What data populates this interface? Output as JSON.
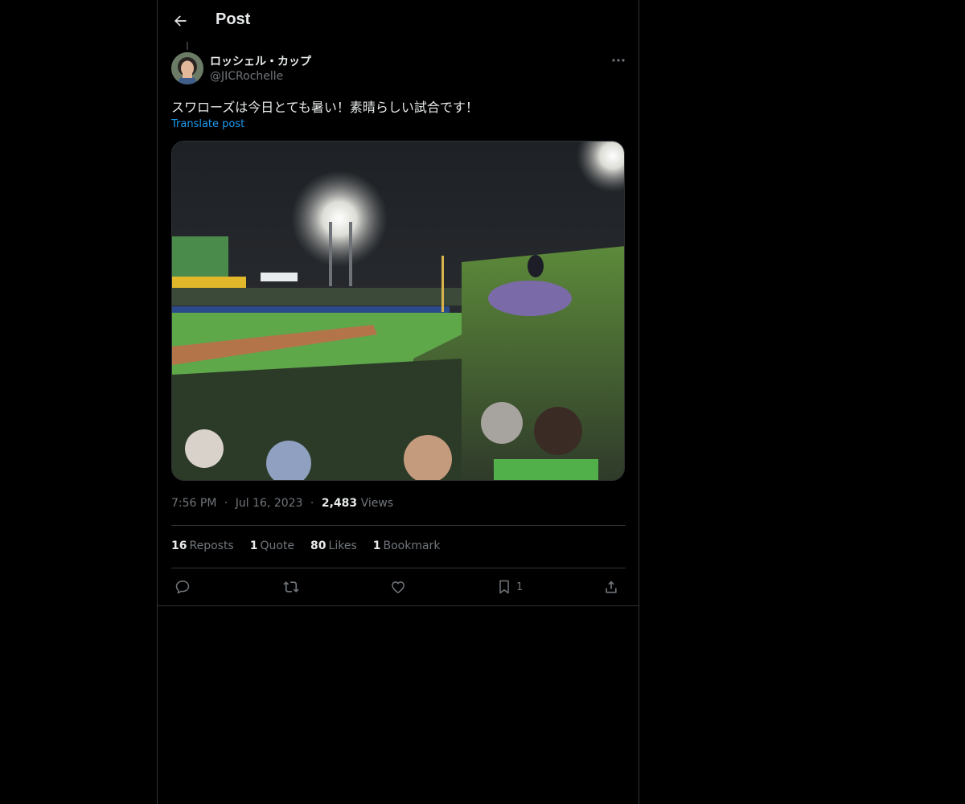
{
  "header": {
    "title": "Post",
    "back_icon": "arrow-left-icon"
  },
  "post": {
    "author_name": "ロッシェル・カップ",
    "author_handle": "@JICRochelle",
    "text": "スワローズは今日とても暑い！素晴らしい試合です！",
    "translate_label": "Translate post",
    "time": "7:56 PM",
    "date": "Jul 16, 2023",
    "views_count": "2,483",
    "views_label": "Views",
    "separator": "·"
  },
  "stats": [
    {
      "count": "16",
      "label": "Reposts"
    },
    {
      "count": "1",
      "label": "Quote"
    },
    {
      "count": "80",
      "label": "Likes"
    },
    {
      "count": "1",
      "label": "Bookmark"
    }
  ],
  "actions": {
    "reply_icon": "reply-icon",
    "repost_icon": "repost-icon",
    "like_icon": "heart-icon",
    "bookmark_icon": "bookmark-icon",
    "bookmark_count": "1",
    "share_icon": "share-icon"
  },
  "colors": {
    "accent": "#1d9bf0",
    "text": "#e7e9ea",
    "secondary": "#71767b",
    "border": "#2f3336"
  }
}
